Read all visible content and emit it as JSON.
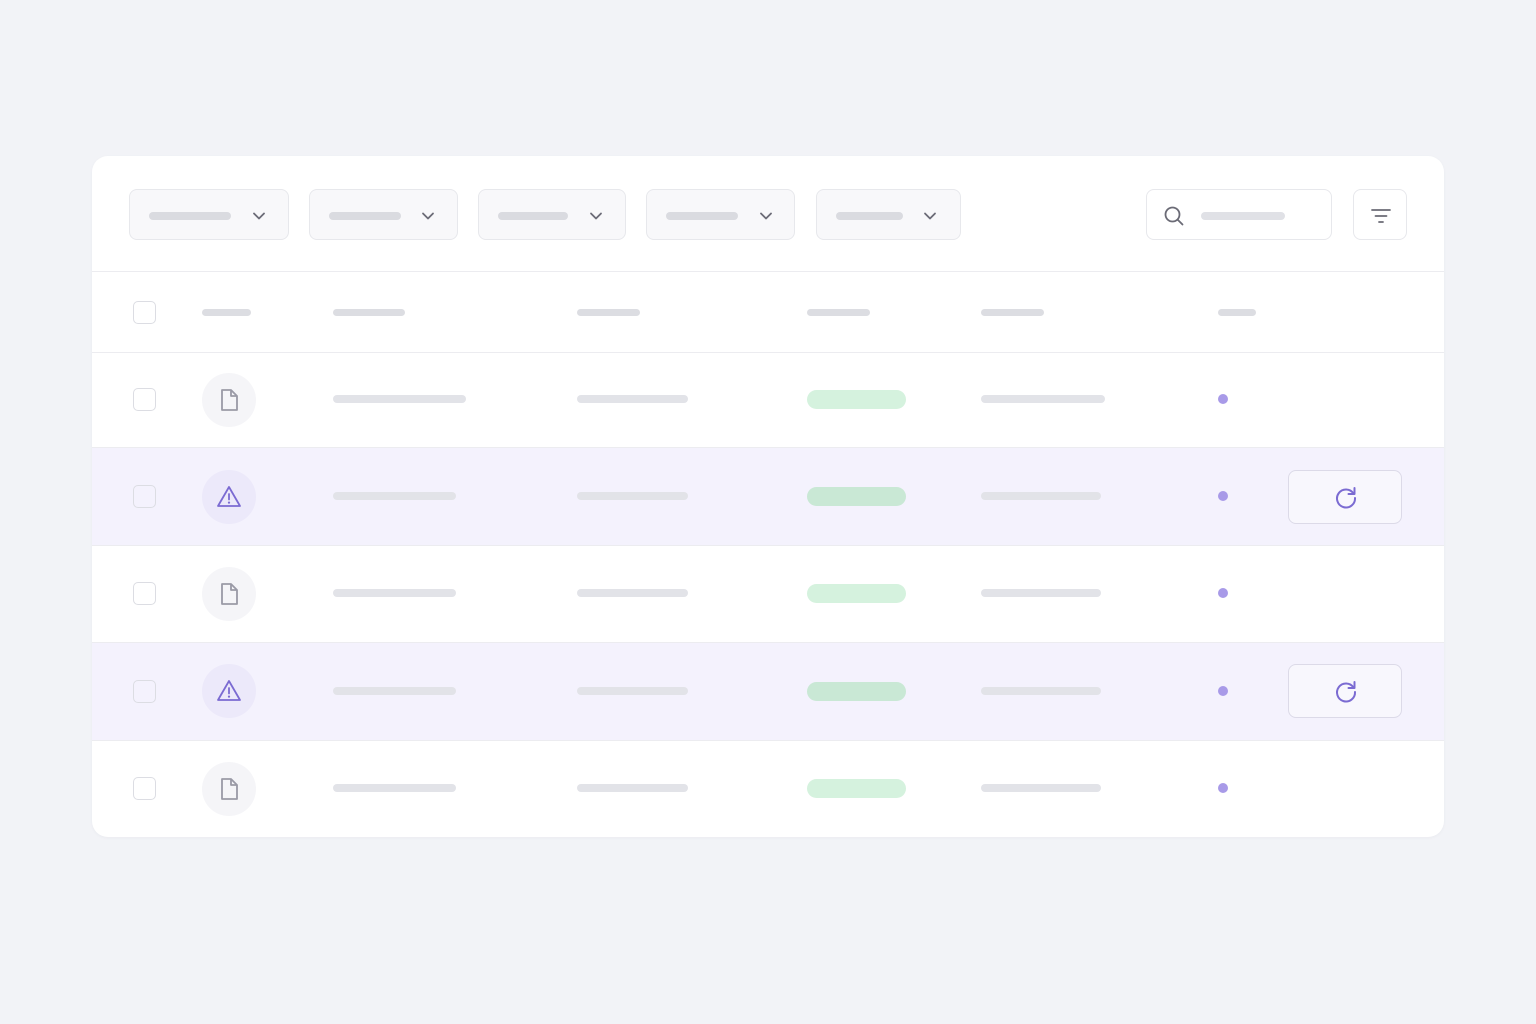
{
  "colors": {
    "page_background": "#f2f3f7",
    "card_background": "#ffffff",
    "skeleton_bar": "#e2e3e8",
    "highlight_row": "#f4f2fd",
    "status_pill_normal": "#d5f2de",
    "status_pill_warning": "#c9e8d5",
    "accent_purple": "#7b6bd2",
    "dot_purple": "#a89ae8",
    "file_icon_stroke": "#9a9aa6"
  },
  "toolbar": {
    "dropdowns": [
      {
        "name": "filter-dropdown-1",
        "icon": "chevron-down-icon"
      },
      {
        "name": "filter-dropdown-2",
        "icon": "chevron-down-icon"
      },
      {
        "name": "filter-dropdown-3",
        "icon": "chevron-down-icon"
      },
      {
        "name": "filter-dropdown-4",
        "icon": "chevron-down-icon"
      },
      {
        "name": "filter-dropdown-5",
        "icon": "chevron-down-icon"
      }
    ],
    "search": {
      "icon": "search-icon"
    },
    "filter_button": {
      "icon": "filter-lines-icon"
    }
  },
  "table": {
    "header": {
      "select_all": "checkbox"
    },
    "rows": [
      {
        "type_icon": "file-icon",
        "state": "normal",
        "has_retry": false
      },
      {
        "type_icon": "warning-icon",
        "state": "warning",
        "has_retry": true,
        "retry_icon": "refresh-icon"
      },
      {
        "type_icon": "file-icon",
        "state": "normal",
        "has_retry": false
      },
      {
        "type_icon": "warning-icon",
        "state": "warning",
        "has_retry": true,
        "retry_icon": "refresh-icon"
      },
      {
        "type_icon": "file-icon",
        "state": "normal",
        "has_retry": false
      }
    ]
  }
}
